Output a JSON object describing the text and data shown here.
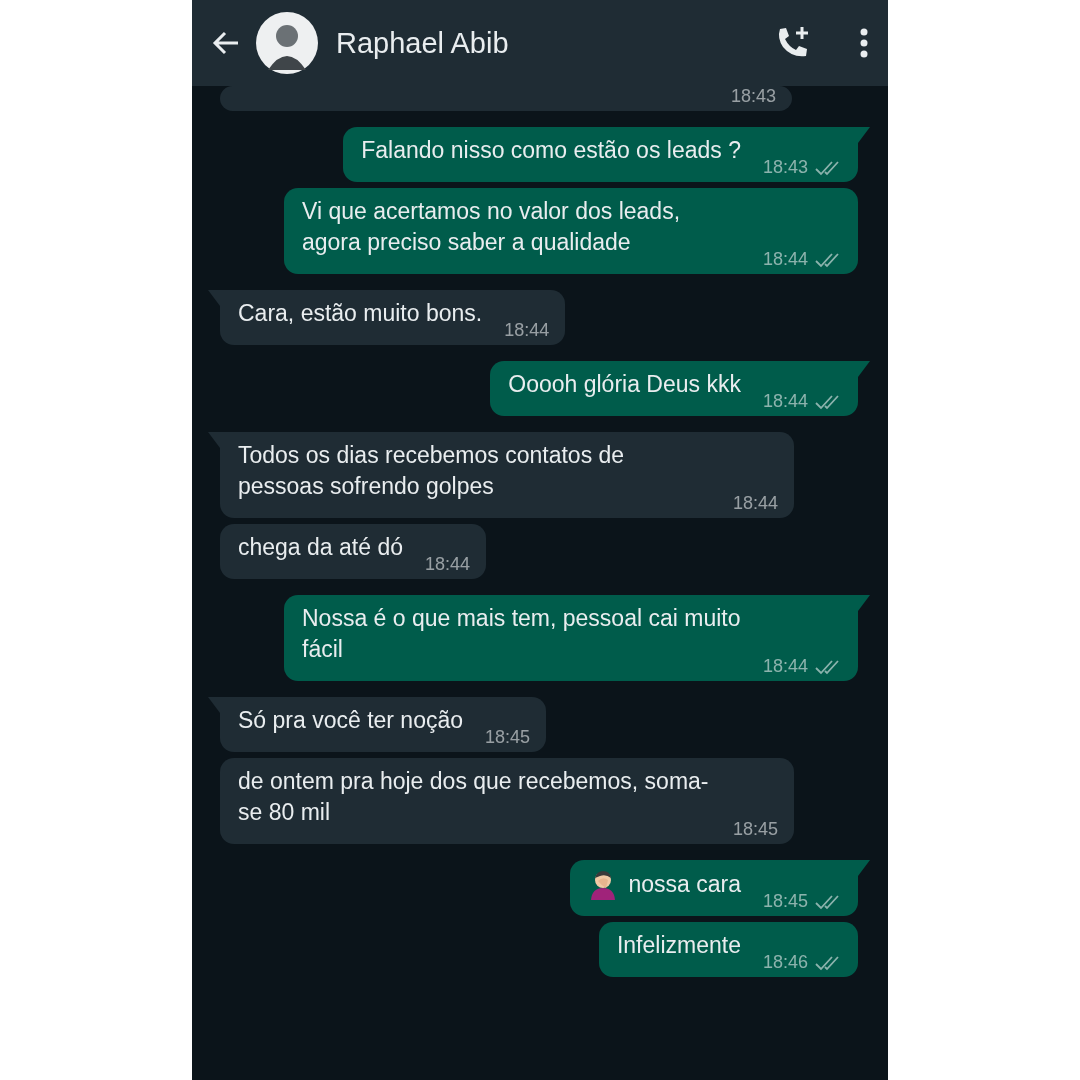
{
  "header": {
    "title": "Raphael Abib"
  },
  "messages": [
    {
      "kind": "in",
      "time": "18:43",
      "tail": false
    },
    {
      "kind": "out",
      "text": "Falando nisso como estão os leads ?",
      "time": "18:43",
      "tail": true,
      "read": true
    },
    {
      "kind": "out",
      "text": "Vi que acertamos no valor dos leads, agora preciso saber a qualidade",
      "time": "18:44",
      "tail": false,
      "read": true
    },
    {
      "kind": "in",
      "text": "Cara, estão muito bons.",
      "time": "18:44",
      "tail": true
    },
    {
      "kind": "out",
      "text": "Ooooh glória Deus kkk",
      "time": "18:44",
      "tail": true,
      "read": true
    },
    {
      "kind": "in",
      "text": "Todos os dias recebemos contatos de pessoas sofrendo golpes",
      "time": "18:44",
      "tail": true
    },
    {
      "kind": "in",
      "text": "chega da até dó",
      "time": "18:44",
      "tail": false
    },
    {
      "kind": "out",
      "text": "Nossa é o que mais tem, pessoal cai muito fácil",
      "time": "18:44",
      "tail": true,
      "read": true
    },
    {
      "kind": "in",
      "text": "Só pra você ter noção",
      "time": "18:45",
      "tail": true
    },
    {
      "kind": "in",
      "text": "de ontem pra hoje dos que recebemos, soma-se 80 mil",
      "time": "18:45",
      "tail": false
    },
    {
      "kind": "out",
      "text": "nossa cara",
      "time": "18:45",
      "tail": true,
      "read": true,
      "emoji": true
    },
    {
      "kind": "out",
      "text": "Infelizmente",
      "time": "18:46",
      "tail": false,
      "read": true
    }
  ]
}
